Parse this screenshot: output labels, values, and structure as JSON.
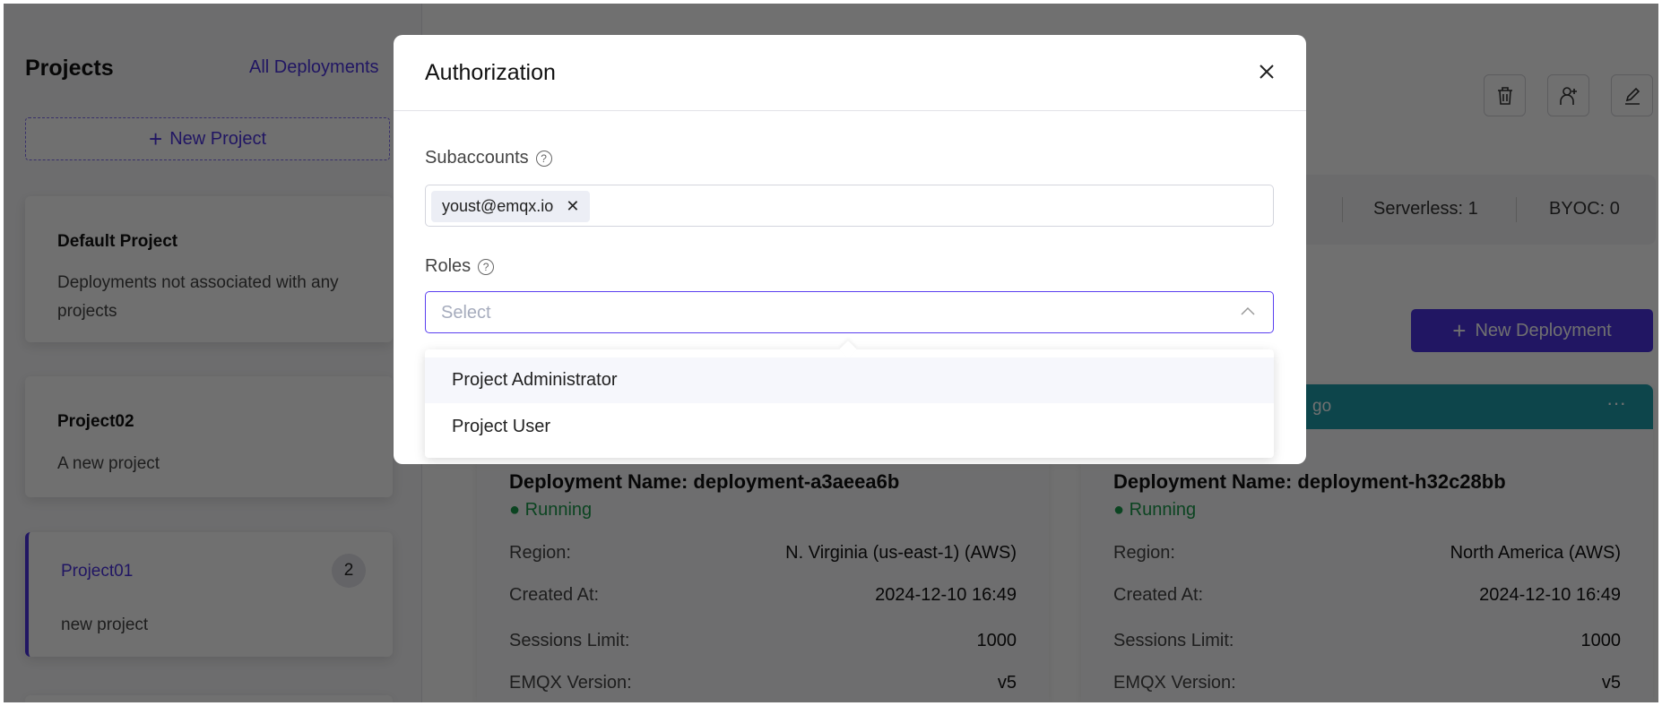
{
  "sidebar": {
    "title": "Projects",
    "all_deployments": "All Deployments",
    "new_project": "New Project",
    "projects": [
      {
        "name": "Default Project",
        "description": "Deployments not associated with any projects"
      },
      {
        "name": "Project02",
        "description": "A new project"
      },
      {
        "name": "Project01",
        "description": "new project",
        "count": "2",
        "active": true
      }
    ]
  },
  "toolbar": {
    "icons": [
      "trash-icon",
      "add-user-icon",
      "edit-icon"
    ]
  },
  "stats": {
    "serverless": "Serverless: 1",
    "byoc": "BYOC: 0"
  },
  "new_deployment": "New Deployment",
  "deployments": [
    {
      "header": "",
      "name": "Deployment Name: deployment-a3aeea6b",
      "status": "Running",
      "rows": [
        [
          "Region:",
          "N. Virginia (us-east-1) (AWS)"
        ],
        [
          "Created At:",
          "2024-12-10 16:49"
        ],
        [
          "Sessions Limit:",
          "1000"
        ],
        [
          "EMQX Version:",
          "v5"
        ]
      ]
    },
    {
      "header": "go",
      "name": "Deployment Name: deployment-h32c28bb",
      "status": "Running",
      "rows": [
        [
          "Region:",
          "North America (AWS)"
        ],
        [
          "Created At:",
          "2024-12-10 16:49"
        ],
        [
          "Sessions Limit:",
          "1000"
        ],
        [
          "EMQX Version:",
          "v5"
        ]
      ]
    }
  ],
  "modal": {
    "title": "Authorization",
    "subaccounts_label": "Subaccounts",
    "subaccount_tag": "youst@emqx.io",
    "roles_label": "Roles",
    "roles_placeholder": "Select",
    "options": [
      "Project Administrator",
      "Project User"
    ]
  },
  "colors": {
    "accent": "#4a33e0",
    "teal": "#1e9cab",
    "running": "#1a9a4a"
  }
}
